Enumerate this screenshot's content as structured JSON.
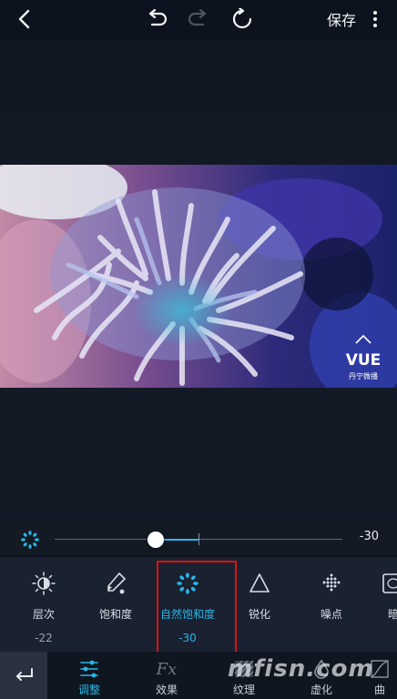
{
  "toolbar": {
    "save_label": "保存"
  },
  "photo": {
    "logo_text": "VUE",
    "logo_sub": "丹宁微播"
  },
  "slider": {
    "value_label": "-30",
    "value": -30,
    "min": -100,
    "max": 100
  },
  "tools": [
    {
      "label": "层次",
      "value": "-22",
      "icon": "contrast-icon"
    },
    {
      "label": "饱和度",
      "value": "",
      "icon": "dropper-icon"
    },
    {
      "label": "自然饱和度",
      "value": "-30",
      "icon": "vibrance-icon",
      "active": true
    },
    {
      "label": "锐化",
      "value": "",
      "icon": "triangle-icon"
    },
    {
      "label": "噪点",
      "value": "",
      "icon": "grain-icon"
    },
    {
      "label": "暗",
      "value": "",
      "icon": "vignette-icon"
    }
  ],
  "tabs": [
    {
      "label": "调整",
      "icon": "adjust-sliders-icon",
      "active": true
    },
    {
      "label": "效果",
      "icon": "fx-icon"
    },
    {
      "label": "纹理",
      "icon": "texture-icon"
    },
    {
      "label": "虚化",
      "icon": "drop-icon"
    },
    {
      "label": "曲",
      "icon": "curve-icon"
    }
  ],
  "watermark": "mfisn.com",
  "colors": {
    "accent": "#29b6e8",
    "highlight": "#e01010",
    "panel": "#1a2130"
  }
}
